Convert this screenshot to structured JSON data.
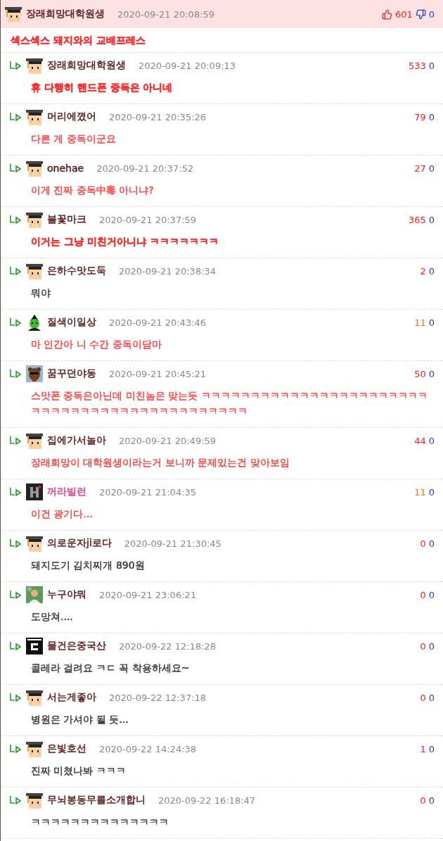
{
  "post": {
    "kind": "student",
    "nickname": {
      "text": "장래희망대학원생",
      "color": "#5a1a1a"
    },
    "time": "2020-09-21 20:08:59",
    "likes": {
      "text": "601",
      "color": "#ff1a1a"
    },
    "dislikes": "0",
    "comment": {
      "text": "섹스섹스 돼지와의 교배프레스",
      "color": "#ff2a2a",
      "bold": true
    }
  },
  "replies": [
    {
      "kind": "student",
      "nickname": {
        "text": "장래희망대학원생",
        "color": "#5a1a1a"
      },
      "time": "2020-09-21 20:09:13",
      "likes": {
        "text": "533",
        "color": "#ff1a1a"
      },
      "dislikes": "0",
      "comment": {
        "text": "휴 다행히 핸드폰 중독은 아니네",
        "color": "#ff2a2a",
        "bold": true
      }
    },
    {
      "kind": "student",
      "nickname": {
        "text": "머리에꼈어",
        "color": "#5a1a1a"
      },
      "time": "2020-09-21 20:35:26",
      "likes": {
        "text": "79",
        "color": "#ff1a1a"
      },
      "dislikes": "0",
      "comment": {
        "text": "다른 게 중독이군요",
        "color": "#ff3a3a",
        "bold": false
      }
    },
    {
      "kind": "student",
      "nickname": {
        "text": "onehae",
        "color": "#5a1a1a"
      },
      "time": "2020-09-21 20:37:52",
      "likes": {
        "text": "27",
        "color": "#ff1a1a"
      },
      "dislikes": "0",
      "comment": {
        "text": "이게 진짜 중독中毒 아니냐?",
        "color": "#ff3a3a",
        "bold": false
      }
    },
    {
      "kind": "student",
      "nickname": {
        "text": "불꽃마크",
        "color": "#5a1a1a"
      },
      "time": "2020-09-21 20:37:59",
      "likes": {
        "text": "365",
        "color": "#ff1a1a"
      },
      "dislikes": "0",
      "comment": {
        "text": "이거는 그냥 미친거아니냐 ㅋㅋㅋㅋㅋㅋㅋ",
        "color": "#ff2a2a",
        "bold": true
      }
    },
    {
      "kind": "student",
      "nickname": {
        "text": "은하수맛도둑",
        "color": "#5a1a1a"
      },
      "time": "2020-09-21 20:38:34",
      "likes": {
        "text": "2",
        "color": "#ff1a1a"
      },
      "dislikes": "0",
      "comment": {
        "text": "뭐야",
        "color": "#333333",
        "bold": false
      }
    },
    {
      "kind": "witch",
      "nickname": {
        "text": "질색이일상",
        "color": "#5a1a1a"
      },
      "time": "2020-09-21 20:43:46",
      "likes": {
        "text": "11",
        "color": "#ff6a1a"
      },
      "dislikes": "0",
      "comment": {
        "text": "마 인간아 니 수간 중독이담마",
        "color": "#ff3a3a",
        "bold": false
      }
    },
    {
      "kind": "bear",
      "nickname": {
        "text": "꿈꾸던야동",
        "color": "#5a1a1a"
      },
      "time": "2020-09-21 20:45:21",
      "likes": {
        "text": "50",
        "color": "#ff1a1a"
      },
      "dislikes": "0",
      "comment": {
        "text": "스맛폰 중독은아닌데 미친놈은 맞는듯 ㅋㅋㅋㅋㅋㅋㅋㅋㅋㅋㅋㅋㅋㅋㅋㅋㅋㅋㅋㅋㅋㅋㅋㅋㅋㅋㅋㅋㅋㅋㅋㅋㅋㅋㅋㅋㅋㅋㅋㅋㅋㅋㅋㅋㅋ",
        "color": "#ff3a3a",
        "bold": false
      }
    },
    {
      "kind": "student",
      "nickname": {
        "text": "집에가서놀아",
        "color": "#5a1a1a"
      },
      "time": "2020-09-21 20:49:59",
      "likes": {
        "text": "44",
        "color": "#ff1a1a"
      },
      "dislikes": "0",
      "comment": {
        "text": "장래희망이 대학원생이라는거 보니까 문제있는건 맞아보임",
        "color": "#ff3a3a",
        "bold": false
      }
    },
    {
      "kind": "letter",
      "nickname": {
        "text": "꺼라빌런",
        "color": "#e8408c"
      },
      "time": "2020-09-21 21:04:35",
      "likes": {
        "text": "11",
        "color": "#ff6a1a"
      },
      "dislikes": "0",
      "comment": {
        "text": "이건 광기다...",
        "color": "#ff3a3a",
        "bold": false
      }
    },
    {
      "kind": "student",
      "nickname": {
        "text": "의로운자ji로다",
        "color": "#5a1a1a"
      },
      "time": "2020-09-21 21:30:45",
      "likes": {
        "text": "0",
        "color": "#ff1a1a"
      },
      "dislikes": "0",
      "comment": {
        "text": "돼지도기 김치찌개 890원",
        "color": "#333333",
        "bold": false
      }
    },
    {
      "nickname": {
        "text": "누구야뭐",
        "color": "#5a1a1a"
      },
      "time": "2020-09-21 23:06:21",
      "likes": {
        "text": "0",
        "color": "#ff1a1a"
      },
      "dislikes": "0",
      "comment": {
        "text": "도망쳐....",
        "color": "#333333",
        "bold": false
      }
    },
    {
      "kind": "badge",
      "nickname": {
        "text": "물건은중국산",
        "color": "#5a1a1a"
      },
      "time": "2020-09-22 12:18:28",
      "likes": {
        "text": "0",
        "color": "#ff1a1a"
      },
      "dislikes": "0",
      "comment": {
        "text": "콜레라 걸려요 ㅋㄷ 꼭 착용하세요~",
        "color": "#333333",
        "bold": false
      }
    },
    {
      "kind": "student",
      "nickname": {
        "text": "서는게좋아",
        "color": "#5a1a1a"
      },
      "time": "2020-09-22 12:37:18",
      "likes": {
        "text": "0",
        "color": "#ff1a1a"
      },
      "dislikes": "0",
      "comment": {
        "text": "병원은 가셔야 될 듯...",
        "color": "#333333",
        "bold": false
      }
    },
    {
      "kind": "student",
      "nickname": {
        "text": "은빛호선",
        "color": "#5a1a1a"
      },
      "time": "2020-09-22 14:24:38",
      "likes": {
        "text": "1",
        "color": "#e0208a"
      },
      "dislikes": "0",
      "comment": {
        "text": "진짜 미쳤나봐 ㅋㅋㅋ",
        "color": "#333333",
        "bold": false
      }
    },
    {
      "kind": "student",
      "nickname": {
        "text": "무뇌봉동무를소개합니",
        "color": "#5a1a1a"
      },
      "time": "2020-09-22 16:18:47",
      "likes": {
        "text": "0",
        "color": "#ff1a1a"
      },
      "dislikes": "0",
      "comment": {
        "text": "ㅋㅋㅋㅋㅋㅋㅋㅋㅋㅋㅋㅋㅋㅋ",
        "color": "#333333",
        "bold": false
      }
    }
  ]
}
